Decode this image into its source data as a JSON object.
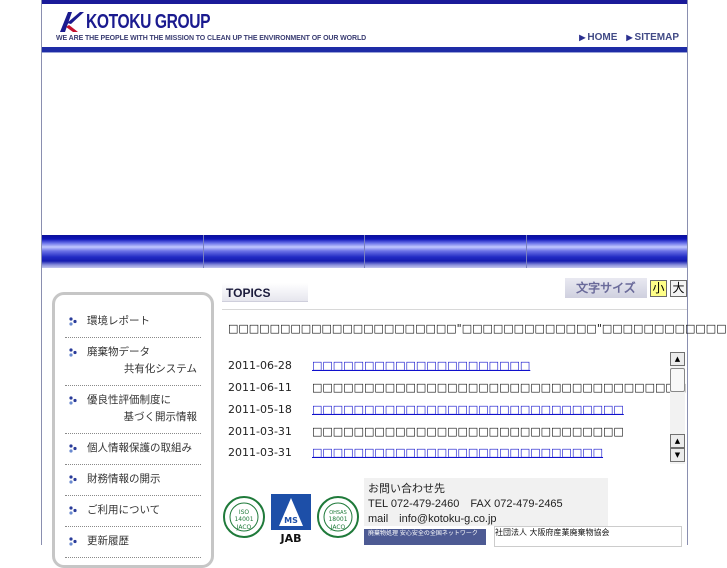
{
  "header": {
    "logo_text": "KOTOKU GROUP",
    "tagline": "WE ARE THE PEOPLE WITH THE MISSION TO CLEAN UP THE ENVIRONMENT OF OUR WORLD",
    "nav": [
      {
        "label": "HOME"
      },
      {
        "label": "SITEMAP"
      }
    ],
    "colors": {
      "brand": "#1a1a8f",
      "rule": "#1e2ca6",
      "logo_red": "#c4122e"
    }
  },
  "sidebar": {
    "items": [
      {
        "line1": "環境レポート",
        "line2": ""
      },
      {
        "line1": "廃棄物データ",
        "line2": "共有化システム"
      },
      {
        "line1": "優良性評価制度に",
        "line2": "基づく開示情報"
      },
      {
        "line1": "個人情報保護の取組み",
        "line2": ""
      },
      {
        "line1": "財務情報の開示",
        "line2": ""
      },
      {
        "line1": "ご利用について",
        "line2": ""
      },
      {
        "line1": "更新履歴",
        "line2": ""
      }
    ]
  },
  "topics": {
    "heading": "TOPICS",
    "font_size_label": "文字サイズ",
    "font_small": "小",
    "font_large": "大",
    "notice": "□□□□□□□□□□□□□□□□□□□□□□\"□□□□□□□□□□□□□\"□□□□□□□□□□□□",
    "news": [
      {
        "date": "2011-06-28",
        "title": "□□□□□□□□□□□□□□□□□□□□□",
        "link": true
      },
      {
        "date": "2011-06-11",
        "title": "□□□□□□□□□□□□□□□□□□□□□□□□□□□□□□□□□□□□□□□□",
        "link": false
      },
      {
        "date": "2011-05-18",
        "title": "□□□□□□□□□□□□□□□□□□□□□□□□□□□□□□",
        "link": true
      },
      {
        "date": "2011-03-31",
        "title": "□□□□□□□□□□□□□□□□□□□□□□□□□□□□□□",
        "link": false
      },
      {
        "date": "2011-03-31",
        "title": "□□□□□□□□□□□□□□□□□□□□□□□□□□□□",
        "link": true
      }
    ]
  },
  "contact": {
    "title": "お問い合わせ先",
    "tel": "TEL 072-479-2460　FAX 072-479-2465",
    "mail": "mail　info@kotoku-g.co.jp"
  },
  "certifications": [
    {
      "top": "ISO",
      "mid": "14001",
      "bottom": "JACO"
    },
    {
      "top": "",
      "mid": "MS",
      "bottom": "JAB"
    },
    {
      "top": "OHSAS",
      "mid": "18001",
      "bottom": "JACO"
    }
  ],
  "banners": [
    {
      "text": "廃棄物処理 安心安全の全国ネットワーク"
    },
    {
      "text": "社団法人 大阪府産業廃棄物協会"
    }
  ]
}
